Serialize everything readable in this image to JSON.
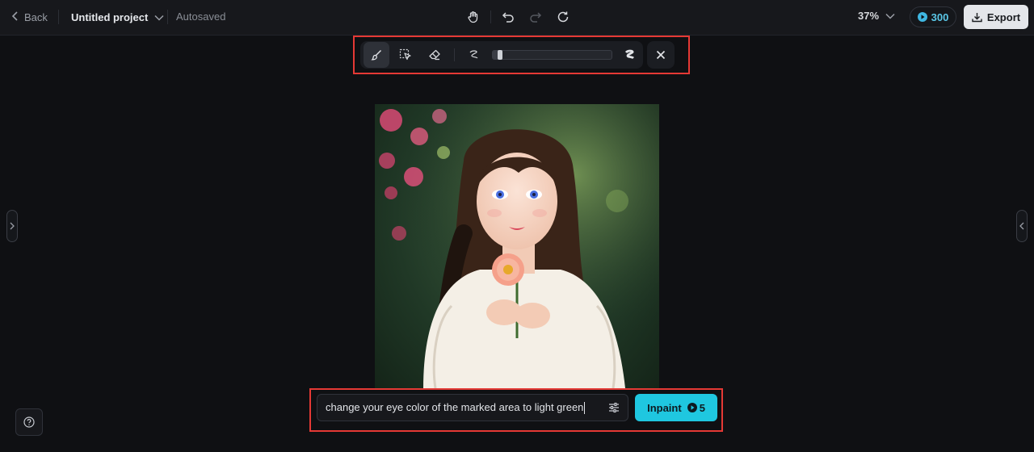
{
  "header": {
    "back_label": "Back",
    "project_name": "Untitled project",
    "autosave_status": "Autosaved",
    "zoom_level": "37%",
    "credits": "300",
    "export_label": "Export"
  },
  "brush_toolbar": {
    "tools": [
      "brush-icon",
      "smart-select-icon",
      "eraser-icon"
    ],
    "active_tool": "brush-icon",
    "brush_size_fraction": 0.04
  },
  "prompt": {
    "value": "change your eye color of the marked area to light green",
    "inpaint_label": "Inpaint",
    "inpaint_cost": "5"
  },
  "colors": {
    "accent": "#1fc7e0",
    "highlight_box": "#e53935",
    "background": "#0f1013"
  }
}
